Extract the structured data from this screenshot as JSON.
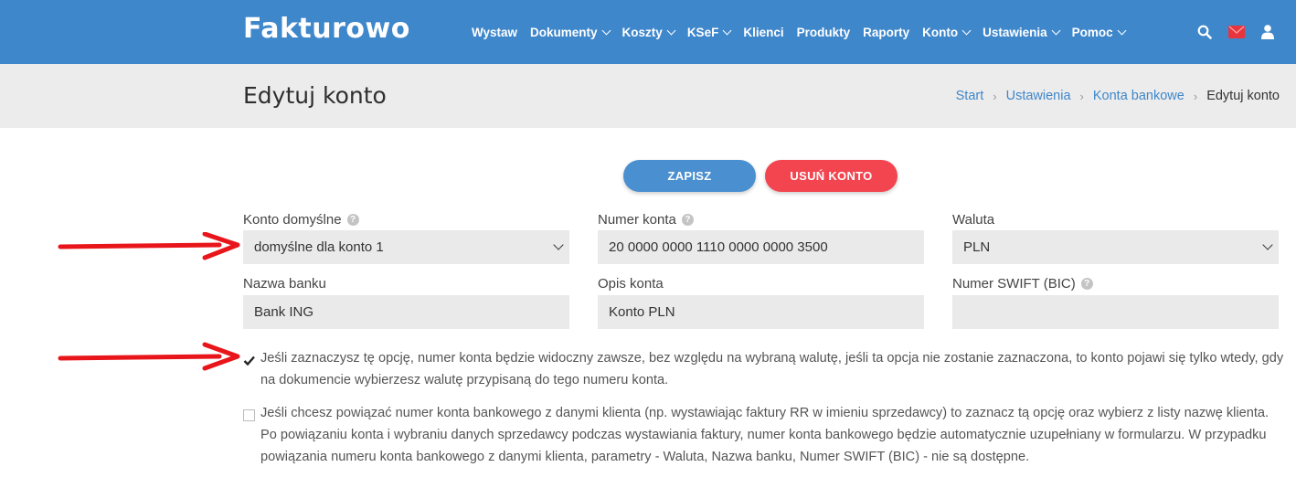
{
  "app": {
    "name": "Fakturowo"
  },
  "nav": {
    "items": [
      {
        "label": "Wystaw",
        "dropdown": false
      },
      {
        "label": "Dokumenty",
        "dropdown": true
      },
      {
        "label": "Koszty",
        "dropdown": true
      },
      {
        "label": "KSeF",
        "dropdown": true
      },
      {
        "label": "Klienci",
        "dropdown": false
      },
      {
        "label": "Produkty",
        "dropdown": false
      },
      {
        "label": "Raporty",
        "dropdown": false
      },
      {
        "label": "Konto",
        "dropdown": true
      },
      {
        "label": "Ustawienia",
        "dropdown": true
      },
      {
        "label": "Pomoc",
        "dropdown": true
      }
    ],
    "icons": [
      "search-icon",
      "mail-icon",
      "user-icon"
    ]
  },
  "page": {
    "title": "Edytuj konto",
    "breadcrumb": [
      "Start",
      "Ustawienia",
      "Konta bankowe",
      "Edytuj konto"
    ]
  },
  "actions": {
    "save_label": "ZAPISZ",
    "delete_label": "USUŃ KONTO"
  },
  "form": {
    "default_account": {
      "label": "Konto domyślne",
      "value": "domyślne dla konto 1"
    },
    "account_number": {
      "label": "Numer konta",
      "value": "20 0000 0000 1110 0000 0000 3500"
    },
    "currency": {
      "label": "Waluta",
      "value": "PLN"
    },
    "bank_name": {
      "label": "Nazwa banku",
      "value": "Bank ING"
    },
    "account_description": {
      "label": "Opis konta",
      "value": "Konto PLN"
    },
    "swift": {
      "label": "Numer SWIFT (BIC)",
      "value": ""
    }
  },
  "options": {
    "always_visible": {
      "checked": true,
      "text": "Jeśli zaznaczysz tę opcję, numer konta będzie widoczny zawsze, bez względu na wybraną walutę, jeśli ta opcja nie zostanie zaznaczona, to konto pojawi się tylko wtedy, gdy na dokumencie wybierzesz walutę przypisaną do tego numeru konta."
    },
    "link_client": {
      "checked": false,
      "text": "Jeśli chcesz powiązać numer konta bankowego z danymi klienta (np. wystawiając faktury RR w imieniu sprzedawcy) to zaznacz tą opcję oraz wybierz z listy nazwę klienta. Po powiązaniu konta i wybraniu danych sprzedawcy podczas wystawiania faktury, numer konta bankowego będzie automatycznie uzupełniany w formularzu. W przypadku powiązania numeru konta bankowego z danymi klienta, parametry - Waluta, Nazwa banku, Numer SWIFT (BIC) - nie są dostępne."
    }
  },
  "colors": {
    "brand": "#3f87cb",
    "save": "#4a8fcf",
    "delete": "#f2454f",
    "arrow": "#e8161b"
  }
}
